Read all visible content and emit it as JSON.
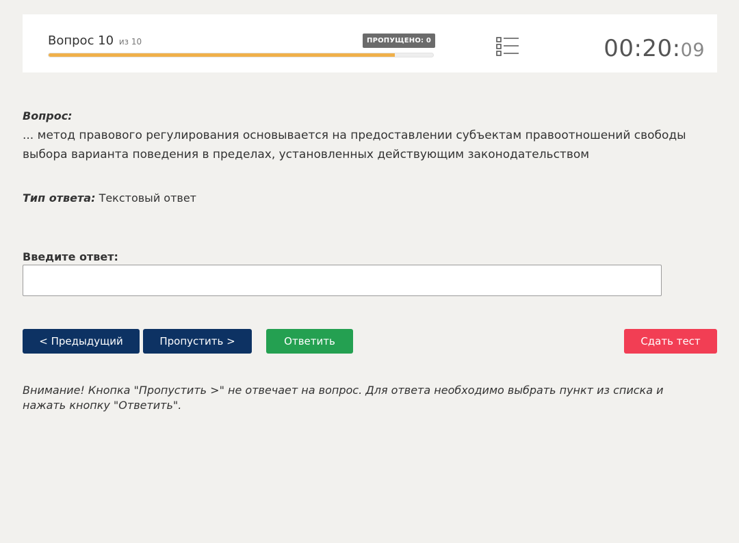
{
  "header": {
    "question_label": "Вопрос 10",
    "question_of": "из 10",
    "skipped_badge": "ПРОПУЩЕНО: 0",
    "progress_fraction": 0.9,
    "timer_main": "00:20:",
    "timer_seconds": "09",
    "list_icon": "question-list-icon"
  },
  "question": {
    "label": "Вопрос:",
    "text": "... метод правового регулирования основывается на предоставлении субъектам правоотношений свободы выбора варианта поведения в пределах, установленных действующим законодательством"
  },
  "answer_type": {
    "label": "Тип ответа:",
    "value": "Текстовый ответ"
  },
  "answer_input": {
    "label": "Введите ответ:",
    "value": "",
    "placeholder": ""
  },
  "buttons": {
    "prev": "< Предыдущий",
    "skip": "Пропустить >",
    "answer": "Ответить",
    "submit": "Сдать тест"
  },
  "colors": {
    "nav_button": "#0d3263",
    "answer_button": "#24a051",
    "submit_button": "#f23e54",
    "progress": "#f0b04a"
  },
  "warning": "Внимание! Кнопка \"Пропустить >\" не отвечает на вопрос. Для ответа необходимо выбрать пункт из списка и нажать кнопку \"Ответить\"."
}
